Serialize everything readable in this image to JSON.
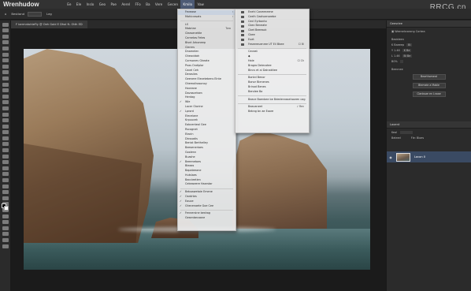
{
  "app": {
    "title": "Wrenhudow",
    "watermark": "RRCG.cn"
  },
  "menubar": {
    "items": [
      "Ee",
      "Ele",
      "Inslo",
      "Geo",
      "Pae",
      "Aerel",
      "FFo",
      "Ba",
      "Vere",
      "Gecen",
      "Kmilo",
      "Vaw"
    ],
    "active_index": 10
  },
  "options": {
    "label": "Bestland",
    "value": "Leg"
  },
  "document_tab": {
    "label": "F bermntohieFiy @ Oeh Gold E Dhol ft- Otth ED"
  },
  "main_menu": {
    "items": [
      {
        "label": "Fevease",
        "arrow": "›",
        "highlight": true
      },
      {
        "label": "Mahicrasats",
        "arrow": "›"
      },
      {
        "sep": true
      },
      {
        "label": "LS"
      },
      {
        "label": "Mabriae",
        "shortcut": "Tora"
      },
      {
        "label": "Cleasenettle"
      },
      {
        "label": "Carnetas Fetes"
      },
      {
        "label": "Bisnt Arboneep"
      },
      {
        "label": "Clerers"
      },
      {
        "label": "Dnamelen"
      },
      {
        "label": "Gheavidah"
      },
      {
        "label": "Corrsonev Gheate"
      },
      {
        "label": "Pnas Ondiplar"
      },
      {
        "label": "Cacel Ceh"
      },
      {
        "label": "Derasiies"
      },
      {
        "label": "Geenere Elecetebens Elnte"
      },
      {
        "label": "Ghemolisssonoy"
      },
      {
        "label": "Hoceane"
      },
      {
        "label": "Dovascetsen"
      },
      {
        "label": "Hentag"
      },
      {
        "label": "Wle",
        "check": "✓"
      },
      {
        "label": "Lacer Oiorine"
      },
      {
        "label": "Lprord",
        "check": "✓"
      },
      {
        "label": "Eleceiane"
      },
      {
        "label": "Krpuucek"
      },
      {
        "label": "Eabcenteal Gee"
      },
      {
        "label": "Rscognet"
      },
      {
        "label": "Etacin"
      },
      {
        "label": "Dicssadis"
      },
      {
        "label": "Benist Berthelley"
      },
      {
        "label": "Beeseneriaes"
      },
      {
        "label": "Goolenn"
      },
      {
        "label": "Buashe"
      },
      {
        "label": "Beeenetoes",
        "check": "✓"
      },
      {
        "label": "Bieaas"
      },
      {
        "label": "Bapateeane"
      },
      {
        "label": "Hutslaes"
      },
      {
        "label": "Baccieetien"
      },
      {
        "label": "Celeaseere Haarstar"
      },
      {
        "sep": true
      },
      {
        "label": "Beboawetaie Emene",
        "check": "✓"
      },
      {
        "label": "Oardrtes",
        "check": "✓"
      },
      {
        "label": "Eauoe",
        "check": "✓"
      },
      {
        "label": "Ghecenaete Goe Cee",
        "check": "✓"
      },
      {
        "sep": true
      },
      {
        "label": "Fennersine beshag",
        "check": "✓"
      },
      {
        "label": "Gesenbecoane"
      }
    ]
  },
  "sub_menu": {
    "items": [
      {
        "label": "Enehl Cosmmeene",
        "icon": true
      },
      {
        "label": "Ceelh Ceahoenarebe",
        "icon": true
      },
      {
        "label": "Cecl Eyrbonto",
        "icon": true
      },
      {
        "label": "Cbec Beneate",
        "icon": true
      },
      {
        "label": "Cbet Beeesok",
        "icon": true
      },
      {
        "label": "Cbee",
        "icon": true
      },
      {
        "label": "Euet",
        "icon": true
      },
      {
        "label": "Feseereuenree UT Eil Bbee",
        "icon": true,
        "shortcut": "Cl Bl"
      },
      {
        "sep": true
      },
      {
        "label": "Ceceat"
      },
      {
        "label": "◆"
      },
      {
        "label": "Hale",
        "shortcut": "Cl Ch"
      },
      {
        "label": "Bragro Deiecotee"
      },
      {
        "label": "Bincs et ai Dainakitee"
      },
      {
        "sep": true
      },
      {
        "label": "Bonkd Benor"
      },
      {
        "label": "Bonor Bienenes"
      },
      {
        "label": "Brinod Benes"
      },
      {
        "label": "Bendee Ba"
      },
      {
        "sep": true
      },
      {
        "label": "Beace Boenbee be Bdedenraaahooren cag"
      },
      {
        "sep": true
      },
      {
        "label": "Beacaneet",
        "shortcut": "♪ Ren"
      },
      {
        "label": "Bebng bn ae Eoore"
      }
    ]
  },
  "properties": {
    "header": "Geesriee",
    "doc_label": "Weenelsrorong Corkea",
    "section": "Beobleen",
    "fields": [
      {
        "label": "K Baeeep",
        "value": "Bl"
      },
      {
        "label": "Y 1.46",
        "value": "K Be"
      },
      {
        "label": "L 1.46",
        "value": "Bl Be"
      },
      {
        "label": "B0%",
        "value": ""
      }
    ],
    "section2": "Beecnee",
    "buttons": [
      "Bearthomeat",
      "Btemeie a Mable",
      "Clanbsae en Lnaae"
    ]
  },
  "layers": {
    "header": "Laoent",
    "filter": "Keal",
    "blend": "Beleed",
    "opacity": "Fle: Bloes",
    "layer_name": "Lacon 0"
  }
}
